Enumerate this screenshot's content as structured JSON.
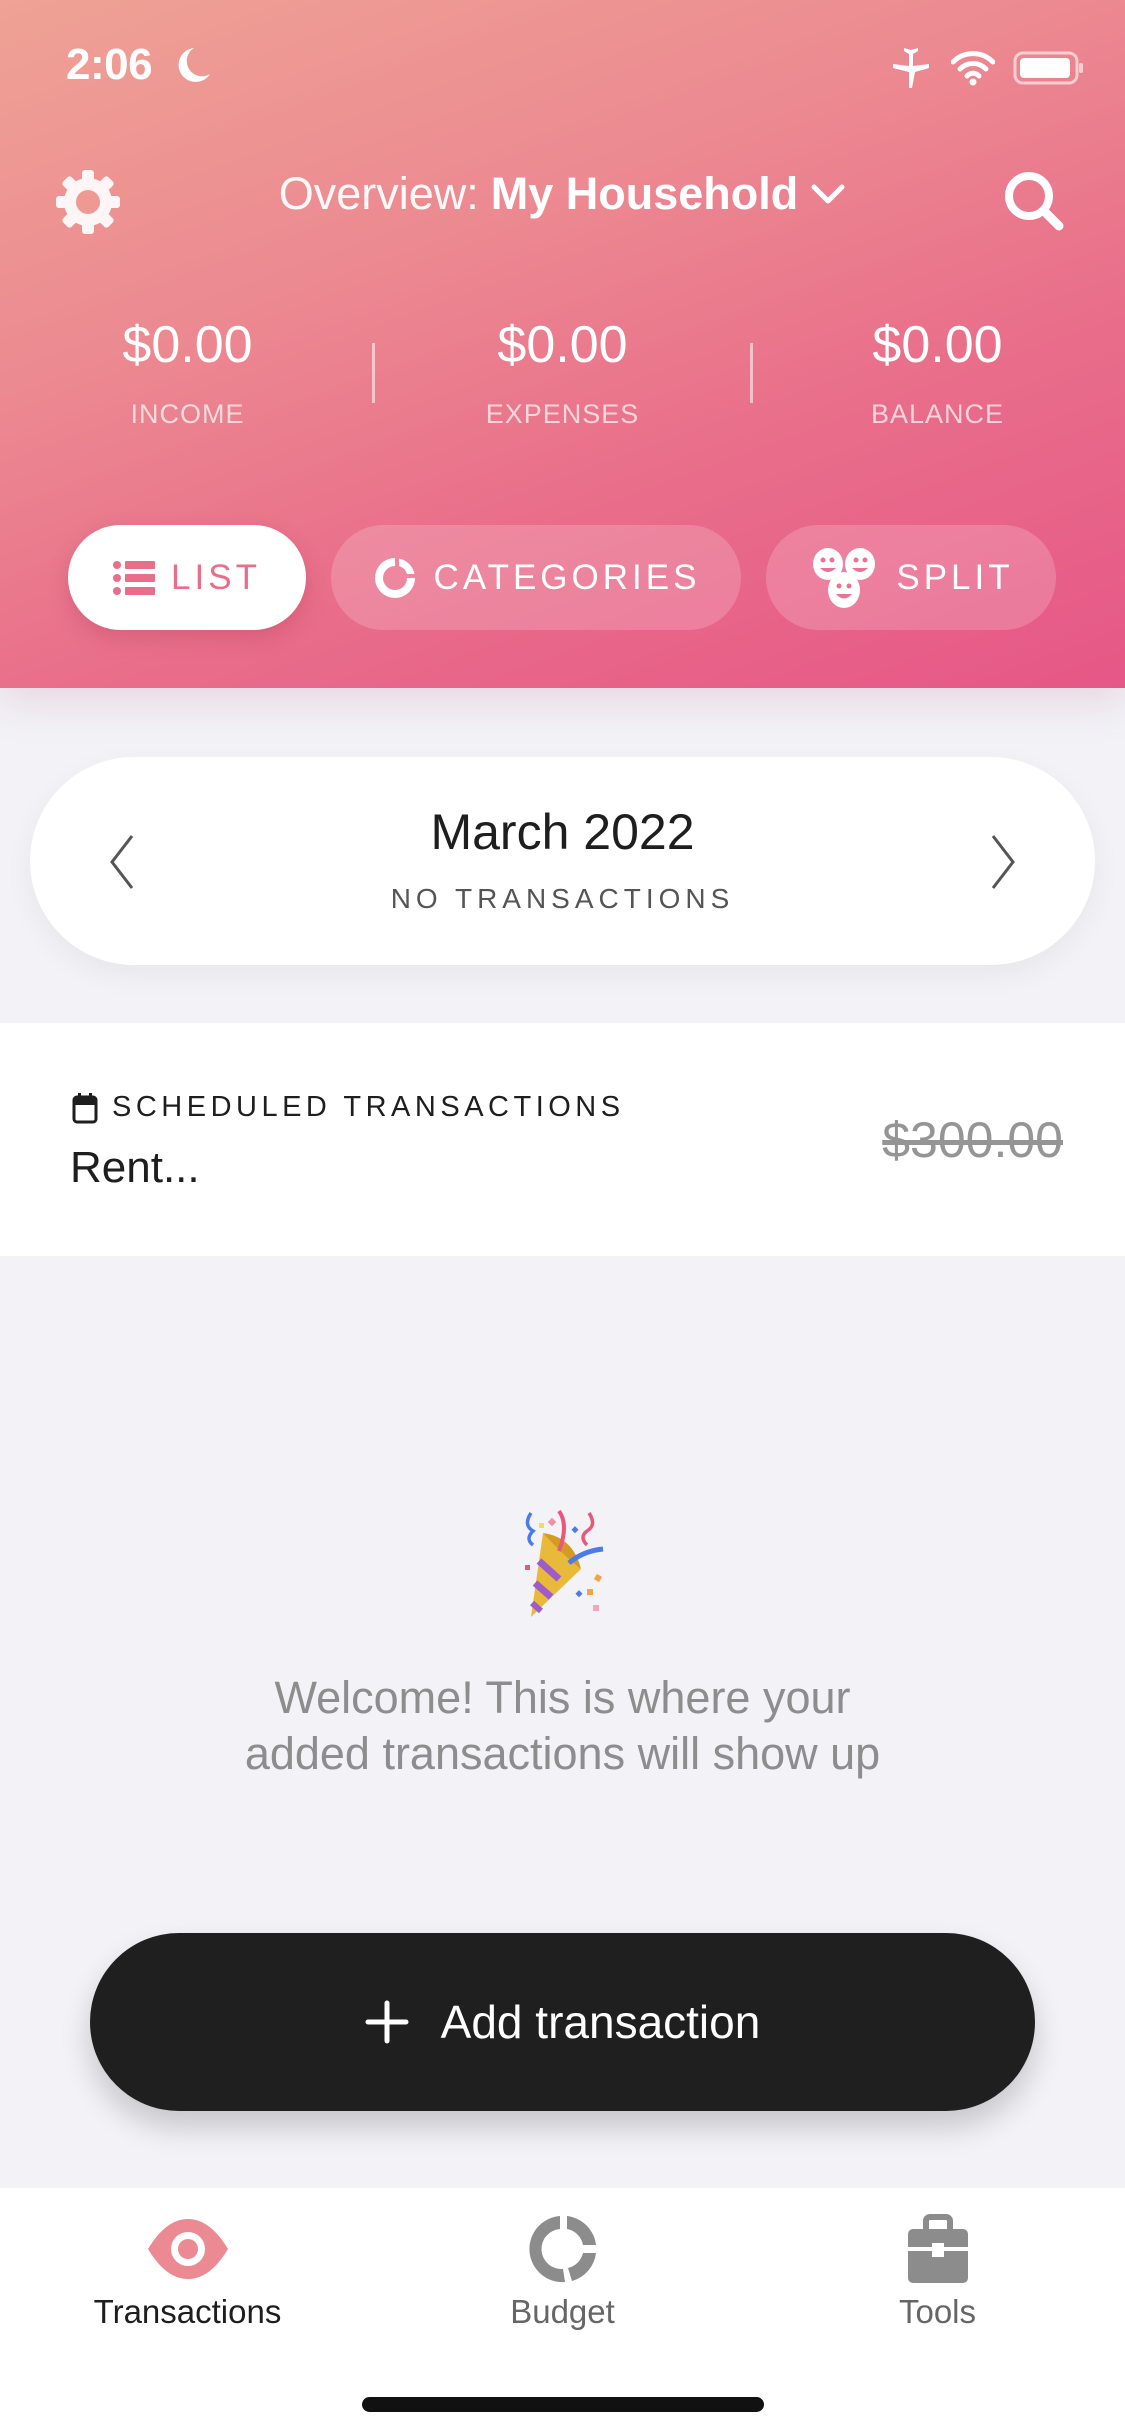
{
  "status_bar": {
    "time": "2:06",
    "icons": [
      "moon-icon",
      "airplane-icon",
      "wifi-icon",
      "battery-icon"
    ]
  },
  "header": {
    "overview_label": "Overview:",
    "household": "My Household",
    "settings_icon": "gear-icon",
    "search_icon": "search-icon",
    "gradient_start": "#EFA295",
    "gradient_end": "#E65787"
  },
  "summary": {
    "income": {
      "amount": "$0.00",
      "label": "INCOME"
    },
    "expenses": {
      "amount": "$0.00",
      "label": "EXPENSES"
    },
    "balance": {
      "amount": "$0.00",
      "label": "BALANCE"
    }
  },
  "view_tabs": [
    {
      "label": "LIST",
      "icon": "list-icon",
      "active": true
    },
    {
      "label": "CATEGORIES",
      "icon": "donut-icon",
      "active": false
    },
    {
      "label": "SPLIT",
      "icon": "faces-icon",
      "active": false
    }
  ],
  "month": {
    "title": "March 2022",
    "subtitle": "NO TRANSACTIONS"
  },
  "scheduled": {
    "title": "SCHEDULED TRANSACTIONS",
    "name": "Rent...",
    "amount": "$300.00"
  },
  "empty_state": {
    "emoji": "party-popper",
    "line1": "Welcome! This is where your",
    "line2": "added transactions will show up"
  },
  "add_button": {
    "label": "Add transaction"
  },
  "tab_bar": [
    {
      "label": "Transactions",
      "icon": "eye-icon",
      "active": true
    },
    {
      "label": "Budget",
      "icon": "donut-icon",
      "active": false
    },
    {
      "label": "Tools",
      "icon": "briefcase-icon",
      "active": false
    }
  ],
  "colors": {
    "accent": "#E96E8A",
    "background": "#F2F2F7",
    "button": "#1F1F1F",
    "active_tab_icon": "#EC8A93",
    "inactive_tab_icon": "#8C8C8C"
  }
}
